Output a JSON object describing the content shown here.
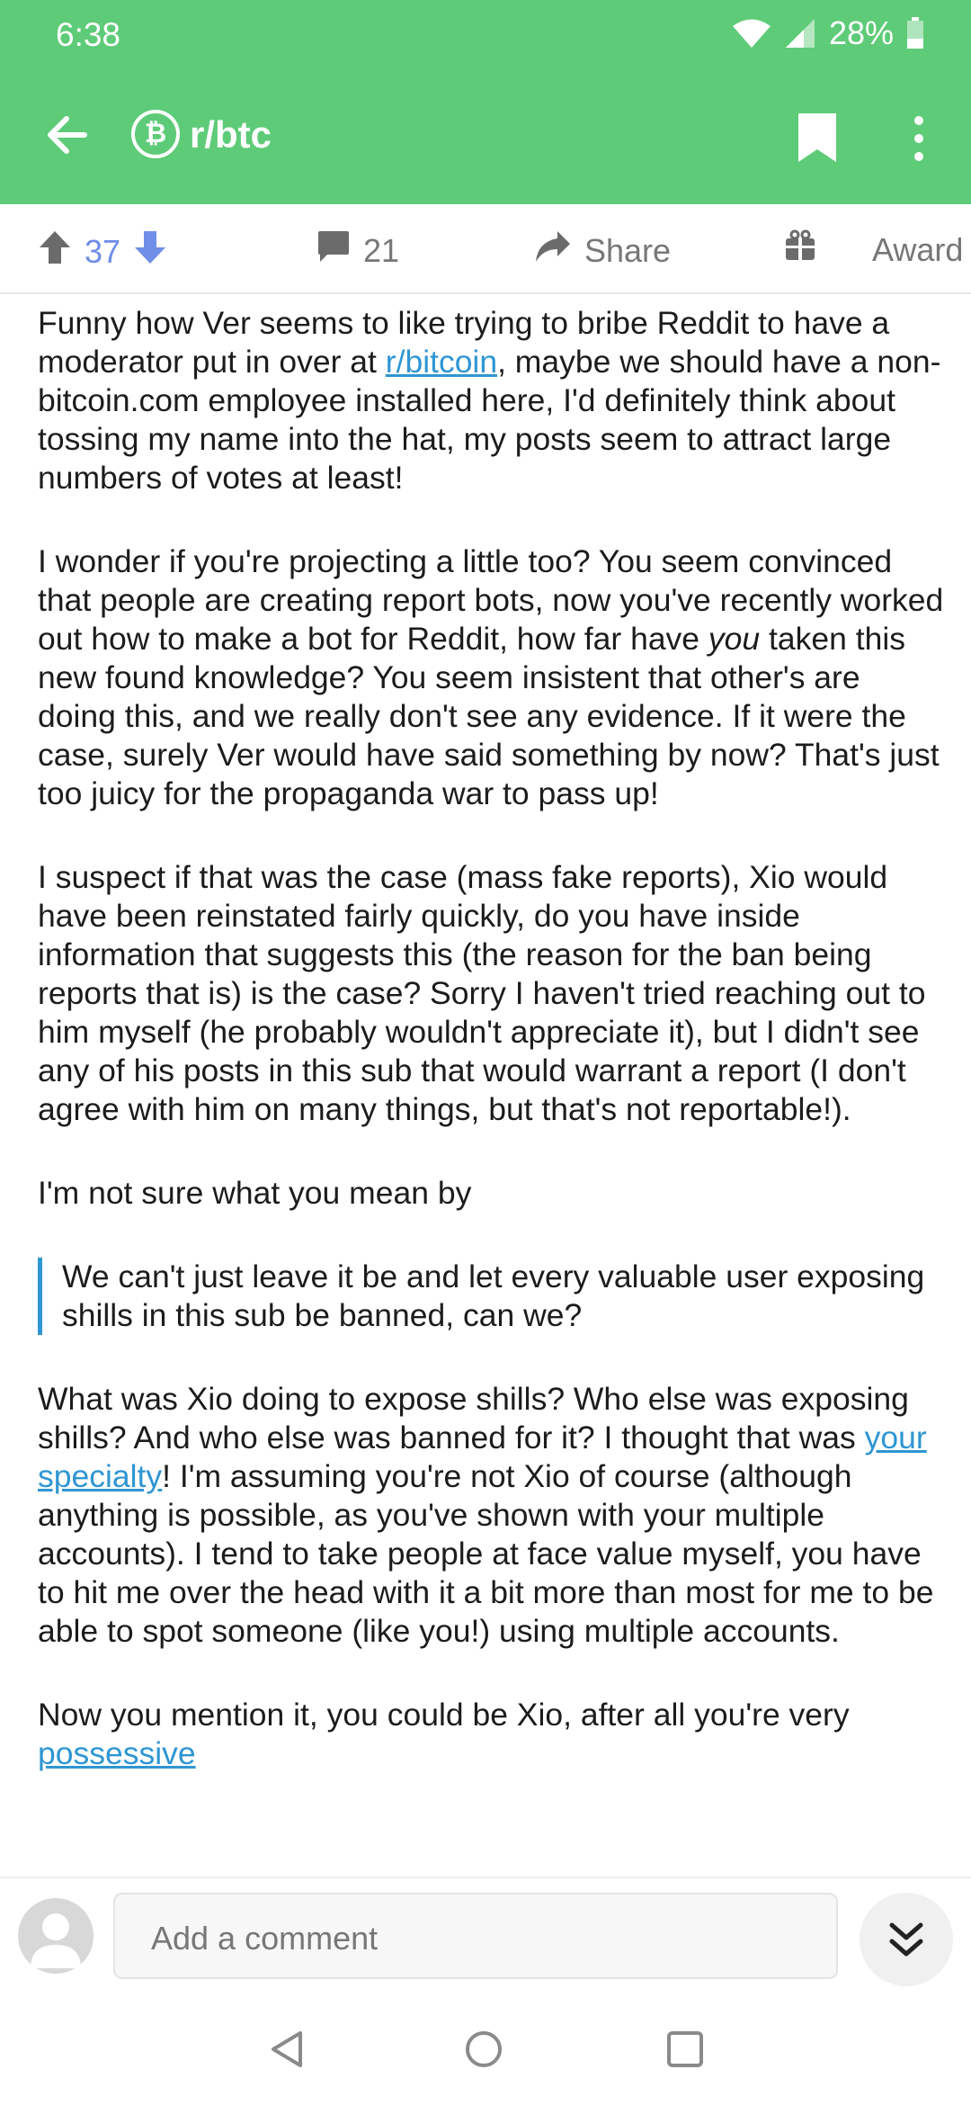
{
  "status": {
    "time": "6:38",
    "battery": "28%"
  },
  "header": {
    "subreddit": "r/btc",
    "sub_icon_glyph": "₿"
  },
  "actions": {
    "score": "37",
    "comments": "21",
    "share": "Share",
    "award": "Award"
  },
  "post": {
    "p1_a": "Funny how Ver seems to like trying to bribe Reddit to have a moderator put in over at ",
    "p1_link": "r/bitcoin",
    "p1_b": ", maybe we should have a non-bitcoin.com employee installed here, I'd definitely think about tossing my name into the hat, my posts seem to attract large numbers of votes at least!",
    "p2_a": "I wonder if you're projecting a little too? You seem convinced that people are creating report bots, now you've recently worked out how to make a bot for Reddit, how far have ",
    "p2_em": "you",
    "p2_b": " taken this new found knowledge?  You seem insistent that other's are doing this, and we really don't see any evidence.  If it were the case, surely Ver would have said something by now? That's just too juicy for the propaganda war to pass up!",
    "p3": "I suspect if that was the case (mass fake reports), Xio would have been reinstated fairly quickly, do you have inside information that suggests this (the reason for the ban being reports that is) is the case?  Sorry I haven't tried reaching out to him myself (he probably wouldn't appreciate it), but I didn't see any of his posts in this sub that would warrant a report (I don't agree with him on many things, but that's not reportable!).",
    "p4": "I'm not sure what you mean by",
    "quote": "We can't just leave it be and let every valuable user exposing shills in this sub be banned, can we?",
    "p5_a": "What was Xio doing to expose shills?  Who else was exposing shills?  And who else was banned for it?  I thought that was ",
    "p5_link": "your specialty",
    "p5_b": "!   I'm assuming you're not Xio of course (although anything is possible, as you've shown with your multiple accounts).  I tend to take people at face value myself, you have to hit me over the head with it a bit more than most for me to be able to spot someone (like you!) using multiple accounts.",
    "p6_a": "Now you mention it, you could be Xio, after all you're very ",
    "p6_link": "possessive"
  },
  "composer": {
    "placeholder": "Add a comment"
  },
  "colors": {
    "header_green": "#5ecb78",
    "vote_blue": "#6f8ee8",
    "link_blue": "#2f96d3"
  },
  "icons": [
    "wifi-icon",
    "signal-icon",
    "battery-icon",
    "back-arrow-icon",
    "bitcoin-icon",
    "bookmark-icon",
    "more-vert-icon",
    "upvote-icon",
    "downvote-icon",
    "comment-icon",
    "share-icon",
    "gift-icon",
    "avatar-icon",
    "double-chevron-down-icon",
    "nav-back-icon",
    "nav-home-icon",
    "nav-recents-icon"
  ]
}
